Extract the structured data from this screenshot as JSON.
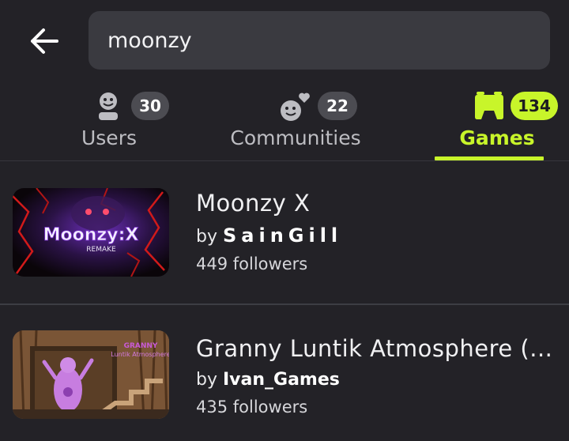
{
  "search": {
    "query": "moonzy"
  },
  "tabs": [
    {
      "label": "Users",
      "count": "30",
      "icon": "user-face-icon"
    },
    {
      "label": "Communities",
      "count": "22",
      "icon": "community-heart-icon"
    },
    {
      "label": "Games",
      "count": "134",
      "icon": "gamepad-icon",
      "active": true
    }
  ],
  "results": [
    {
      "title": "Moonzy X",
      "by": "by",
      "creator": "SainGill",
      "followers": "449 followers",
      "thumb_logo": "Moonzy:X",
      "thumb_sub": "REMAKE"
    },
    {
      "title": "Granny Luntik Atmosphere (...",
      "by": "by",
      "creator": "Ivan_Games",
      "followers": "435 followers",
      "thumb_logo": "GRANNY",
      "thumb_sub": "Luntik Atmosphere"
    }
  ],
  "colors": {
    "background": "#232227",
    "accent": "#c8f52a",
    "search_bg": "#3a3a40",
    "badge_bg": "#4c4c52"
  }
}
